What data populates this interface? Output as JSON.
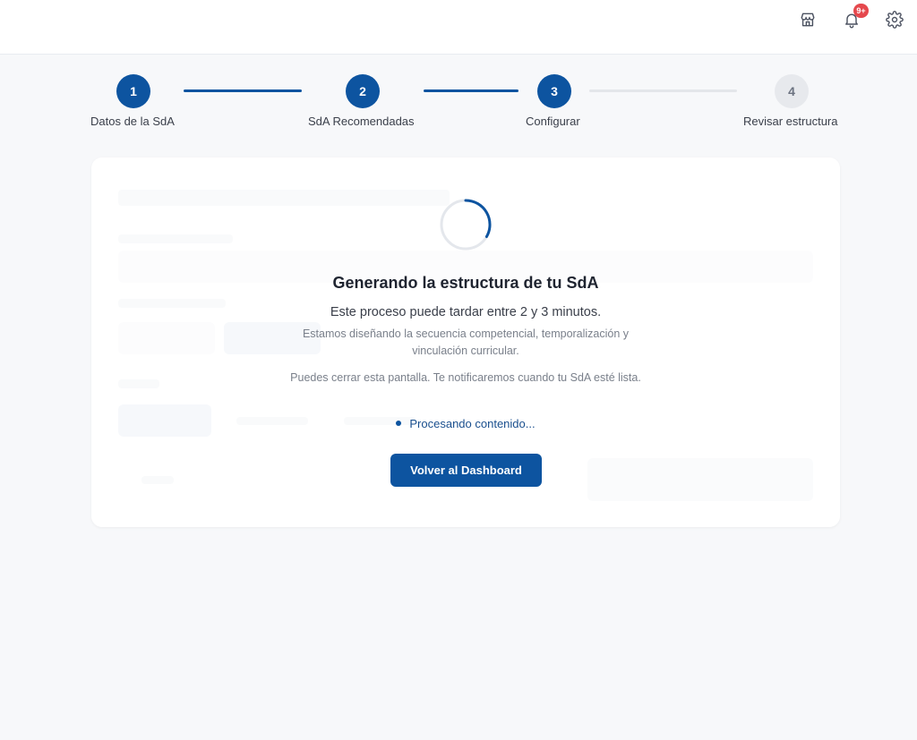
{
  "topbar": {
    "icons": [
      "store-icon",
      "bell-icon",
      "gear-icon"
    ],
    "notification_badge": "9+"
  },
  "stepper": {
    "steps": [
      {
        "number": "1",
        "label": "Datos de la SdA",
        "state": "done"
      },
      {
        "number": "2",
        "label": "SdA Recomendadas",
        "state": "done"
      },
      {
        "number": "3",
        "label": "Configurar",
        "state": "current"
      },
      {
        "number": "4",
        "label": "Revisar estructura",
        "state": "pending"
      }
    ]
  },
  "loading": {
    "title": "Generando la estructura de tu SdA",
    "subtitle": "Este proceso puede tardar entre 2 y 3 minutos.",
    "description": "Estamos diseñando la secuencia competencial, temporalización y vinculación curricular.",
    "notice": "Puedes cerrar esta pantalla. Te notificaremos cuando tu SdA esté lista.",
    "status": "Procesando contenido...",
    "button_label": "Volver al Dashboard"
  },
  "colors": {
    "primary": "#0d54a0",
    "badge": "#e5484d",
    "inactive_step": "#e7e9ed"
  }
}
